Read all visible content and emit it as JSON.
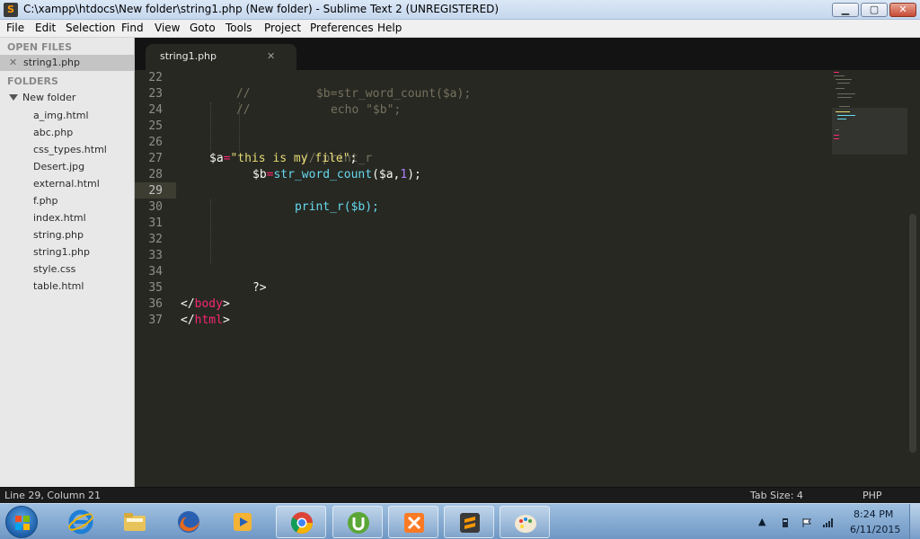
{
  "window": {
    "title": "C:\\xampp\\htdocs\\New folder\\string1.php (New folder) - Sublime Text 2 (UNREGISTERED)",
    "app_icon_glyph": "S",
    "minimize_glyph": "▁",
    "maximize_glyph": "▢",
    "close_glyph": "✕"
  },
  "menu": {
    "items": [
      "File",
      "Edit",
      "Selection",
      "Find",
      "View",
      "Goto",
      "Tools",
      "Project",
      "Preferences",
      "Help"
    ]
  },
  "sidebar": {
    "open_files_heading": "OPEN FILES",
    "open_files": [
      {
        "close_glyph": "✕",
        "label": "string1.php"
      }
    ],
    "folders_heading": "FOLDERS",
    "folder_name": "New folder",
    "files": [
      "a_img.html",
      "abc.php",
      "css_types.html",
      "Desert.jpg",
      "external.html",
      "f.php",
      "index.html",
      "string.php",
      "string1.php",
      "style.css",
      "table.html"
    ]
  },
  "tab": {
    "label": "string1.php",
    "close_glyph": "✕"
  },
  "editor": {
    "line_numbers": [
      "22",
      "23",
      "24",
      "25",
      "26",
      "27",
      "28",
      "29",
      "30",
      "31",
      "32",
      "33",
      "34",
      "35",
      "36",
      "37"
    ],
    "active_line": "29",
    "code": {
      "l22_comment": "//",
      "l22_rest": "$b=str_word_count($a);",
      "l23_comment": "//",
      "l23_rest": "echo \"$b\";",
      "l26": "// print_r",
      "l27_var": "$a",
      "l27_eq": "=",
      "l27_str": "\"this is my file\"",
      "l27_semi": ";",
      "l28_var": "$b",
      "l28_eq": "=",
      "l28_fn": "str_word_count",
      "l28_args_a": "($a,",
      "l28_num": "1",
      "l28_end": ");",
      "l29": "print_r($b);",
      "l34": "?>",
      "l36_open": "</",
      "l36_tag": "body",
      "l36_close": ">",
      "l37_open": "</",
      "l37_tag": "html",
      "l37_close": ">"
    }
  },
  "status": {
    "position": "Line 29, Column 21",
    "tab_size": "Tab Size: 4",
    "syntax": "PHP"
  },
  "taskbar": {
    "clock_time": "8:24 PM",
    "clock_date": "6/11/2015",
    "tray_arrow": "▲",
    "icons": [
      "windows-start-icon",
      "internet-explorer-icon",
      "file-explorer-icon",
      "firefox-icon",
      "media-player-icon",
      "chrome-icon",
      "utorrent-icon",
      "xampp-icon",
      "sublime-text-icon",
      "paint-icon"
    ]
  },
  "colors": {
    "editor_bg": "#272822",
    "comment": "#75715e",
    "string": "#e6db74",
    "number": "#ae81ff",
    "keyword": "#f92672",
    "function": "#66d9ef"
  }
}
